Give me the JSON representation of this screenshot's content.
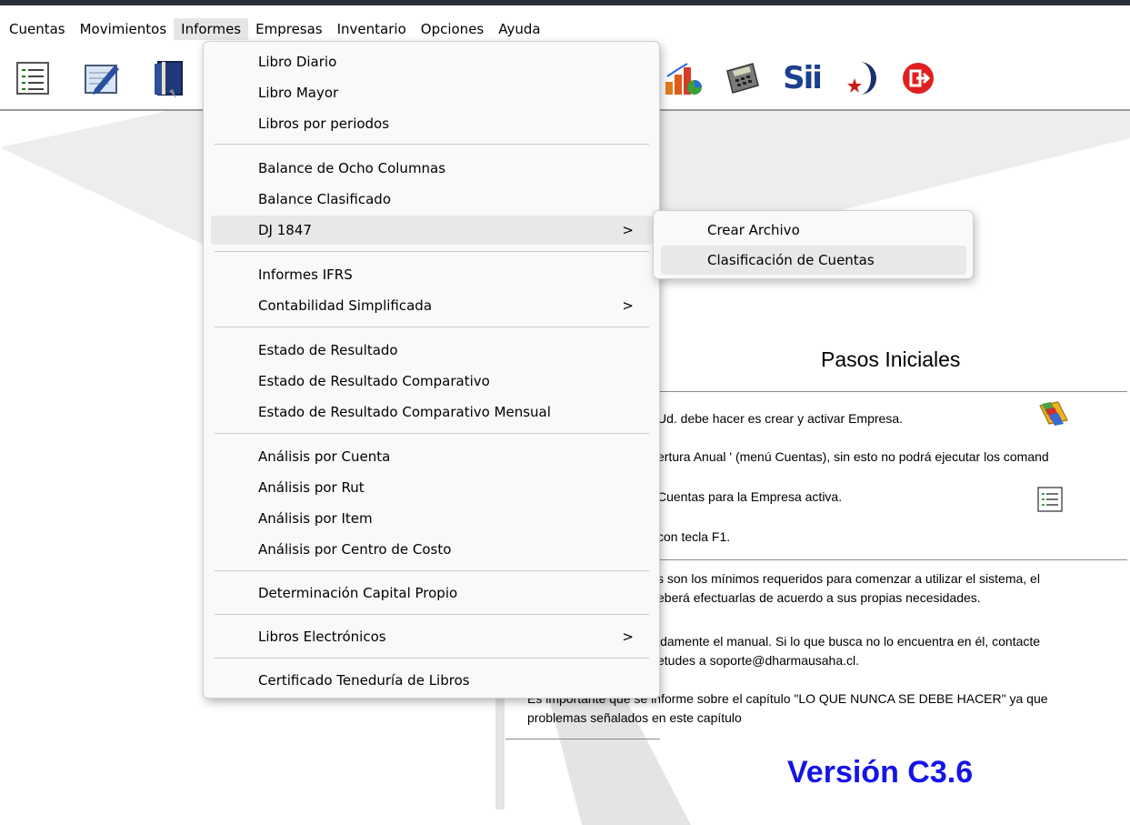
{
  "menubar": {
    "items": [
      "Cuentas",
      "Movimientos",
      "Informes",
      "Empresas",
      "Inventario",
      "Opciones",
      "Ayuda"
    ]
  },
  "toolbar": {
    "icons": [
      "list-icon",
      "edit-icon",
      "book-icon",
      "chart-icon",
      "calculator-icon",
      "sii-icon",
      "chile-moon-icon",
      "exit-icon"
    ],
    "sii_label": "Sii"
  },
  "informes_menu": {
    "items": [
      {
        "label": "Libro Diario",
        "submenu": false
      },
      {
        "label": "Libro Mayor",
        "submenu": false
      },
      {
        "label": "Libros por periodos",
        "submenu": false
      },
      {
        "label": "Balance de Ocho Columnas",
        "submenu": false
      },
      {
        "label": "Balance Clasificado",
        "submenu": false
      },
      {
        "label": "DJ 1847",
        "submenu": true,
        "highlighted": true
      },
      {
        "label": "Informes IFRS",
        "submenu": false
      },
      {
        "label": "Contabilidad Simplificada",
        "submenu": true
      },
      {
        "label": "Estado de Resultado",
        "submenu": false
      },
      {
        "label": "Estado de Resultado Comparativo",
        "submenu": false
      },
      {
        "label": "Estado de Resultado Comparativo Mensual",
        "submenu": false
      },
      {
        "label": "Análisis por Cuenta",
        "submenu": false
      },
      {
        "label": "Análisis por Rut",
        "submenu": false
      },
      {
        "label": "Análisis por Item",
        "submenu": false
      },
      {
        "label": "Análisis por Centro de Costo",
        "submenu": false
      },
      {
        "label": "Determinación Capital Propio",
        "submenu": false
      },
      {
        "label": "Libros Electrónicos",
        "submenu": true
      },
      {
        "label": "Certificado Teneduría de Libros",
        "submenu": false
      }
    ],
    "submenu_arrow": ">"
  },
  "dj1847_submenu": {
    "items": [
      "Crear Archivo",
      "Clasificación de Cuentas"
    ]
  },
  "pasos": {
    "title": "Pasos Iniciales",
    "lines": [
      "Ud. debe hacer es crear y activar Empresa.",
      "ertura Anual ' (menú Cuentas), sin esto no podrá ejecutar los comand",
      "Cuentas para la Empresa activa.",
      "con tecla F1.",
      "s son los mínimos requeridos para comenzar a utilizar el sistema, el",
      "eberá efectuarlas de acuerdo a sus propias necesidades.",
      "idamente el manual. Si lo que busca no lo encuentra en él,  contacte",
      "etudes a soporte@dharmausaha.cl.",
      "Es importante que se informe sobre el capítulo \"LO QUE NUNCA SE DEBE HACER\" ya que",
      "problemas señalados en este capítulo"
    ],
    "version": "Versión C3.6"
  },
  "colors": {
    "menu_bg": "#f9f9f9",
    "highlight": "#e8e8e8",
    "version_blue": "#1414e6"
  }
}
